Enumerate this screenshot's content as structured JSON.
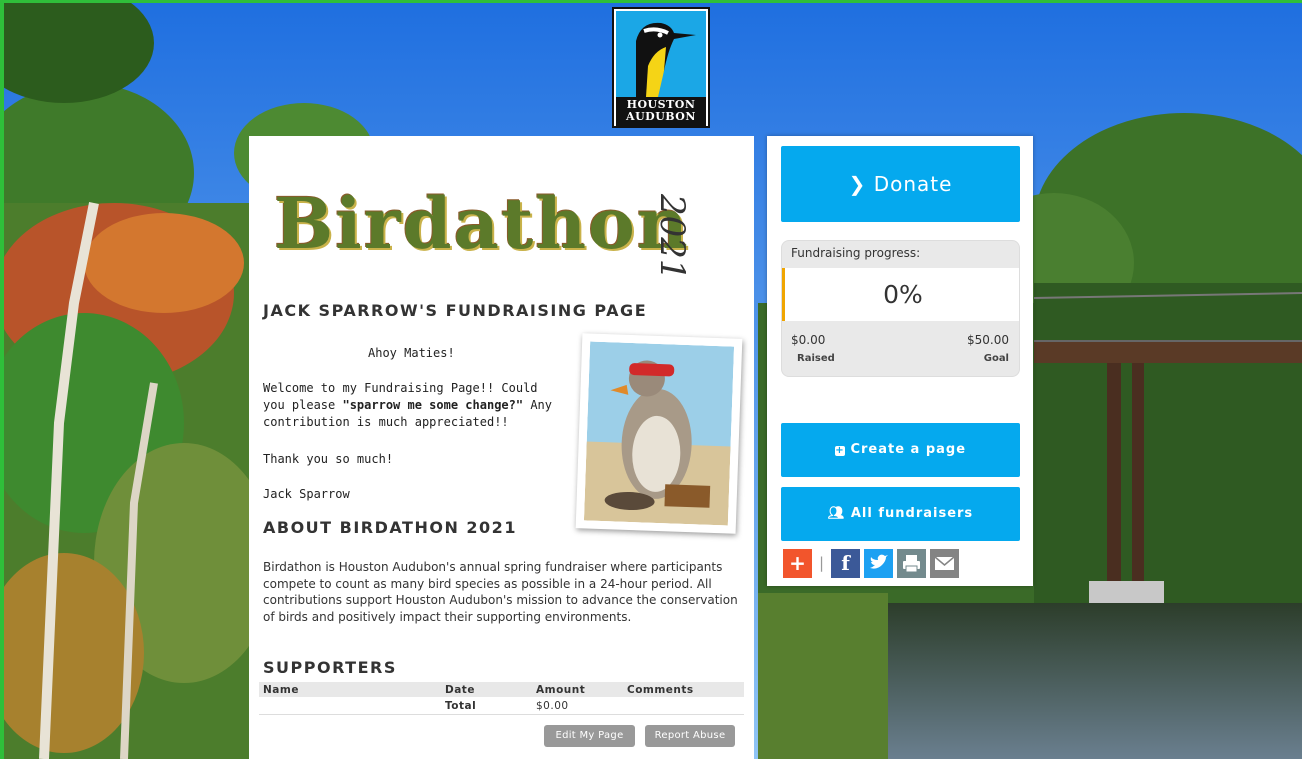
{
  "logo": {
    "line1": "HOUSTON",
    "line2": "AUDUBON"
  },
  "banner": {
    "title": "Birdathon",
    "year": "2021"
  },
  "page": {
    "title": "JACK SPARROW'S FUNDRAISING PAGE",
    "greeting": "Ahoy Maties!",
    "welcome_pre": "Welcome to my Fundraising Page!! Could you please ",
    "welcome_bold": "\"sparrow me some change?\"",
    "welcome_post": " Any contribution is much appreciated!!",
    "thanks": "Thank you so much!",
    "signature": "Jack Sparrow"
  },
  "about": {
    "title": "ABOUT BIRDATHON 2021",
    "text": "Birdathon is Houston Audubon's annual spring fundraiser where participants compete to count as many bird species as possible in a 24-hour period. All contributions support Houston Audubon's mission to advance the conservation of birds and positively impact their supporting environments."
  },
  "supporters": {
    "title": "SUPPORTERS",
    "columns": [
      "Name",
      "Date",
      "Amount",
      "Comments"
    ],
    "total_label": "Total",
    "total_amount": "$0.00"
  },
  "actions": {
    "edit": "Edit My Page",
    "report": "Report Abuse"
  },
  "sidebar": {
    "donate": "Donate",
    "progress_label": "Fundraising progress:",
    "progress_percent": "0%",
    "raised": "$0.00",
    "raised_label": "Raised",
    "goal": "$50.00",
    "goal_label": "Goal",
    "create": "Create a page",
    "all": "All fundraisers",
    "share_separator": "|"
  },
  "colors": {
    "accent": "#05a9ee",
    "progress_bar": "#f0a500",
    "facebook": "#3b5998",
    "twitter": "#1da1f2",
    "add": "#f2552c"
  }
}
